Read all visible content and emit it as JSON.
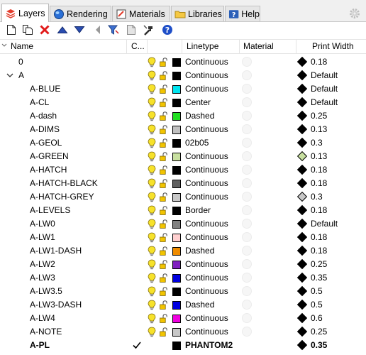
{
  "tabs": [
    {
      "label": "Layers",
      "icon": "layers-icon",
      "active": true
    },
    {
      "label": "Rendering",
      "icon": "rendering-icon",
      "active": false
    },
    {
      "label": "Materials",
      "icon": "materials-icon",
      "active": false
    },
    {
      "label": "Libraries",
      "icon": "libraries-icon",
      "active": false
    },
    {
      "label": "Help",
      "icon": "help-icon",
      "active": false
    }
  ],
  "toolbar": [
    {
      "name": "new-layer-icon"
    },
    {
      "name": "new-sublayer-icon"
    },
    {
      "name": "delete-icon"
    },
    {
      "name": "move-up-icon"
    },
    {
      "name": "move-down-icon"
    },
    {
      "name": "move-to-parent-icon"
    },
    {
      "name": "filter-icon"
    },
    {
      "name": "layer-states-icon"
    },
    {
      "name": "tools-icon"
    },
    {
      "name": "help-icon"
    }
  ],
  "columns": {
    "name": "Name",
    "current": "C...",
    "linetype": "Linetype",
    "material": "Material",
    "print_width": "Print Width"
  },
  "layers": [
    {
      "name": "0",
      "level": 0,
      "color": "#000000",
      "linetype": "Continuous",
      "print_color": "#000000",
      "print_width": "0.18"
    },
    {
      "name": "A",
      "level": 0,
      "expanded": true,
      "color": "#000000",
      "linetype": "Continuous",
      "print_color": "#000000",
      "print_width": "Default"
    },
    {
      "name": "A-BLUE",
      "level": 1,
      "color": "#00e5f0",
      "linetype": "Continuous",
      "print_color": "#000000",
      "print_width": "Default"
    },
    {
      "name": "A-CL",
      "level": 1,
      "color": "#000000",
      "linetype": "Center",
      "print_color": "#000000",
      "print_width": "Default"
    },
    {
      "name": "A-dash",
      "level": 1,
      "color": "#22e022",
      "linetype": "Dashed",
      "print_color": "#000000",
      "print_width": "0.25"
    },
    {
      "name": "A-DIMS",
      "level": 1,
      "color": "#c0c0c0",
      "linetype": "Continuous",
      "print_color": "#000000",
      "print_width": "0.13"
    },
    {
      "name": "A-GEOL",
      "level": 1,
      "color": "#000000",
      "linetype": "02b05",
      "print_color": "#000000",
      "print_width": "0.3"
    },
    {
      "name": "A-GREEN",
      "level": 1,
      "color": "#c8e0a0",
      "linetype": "Continuous",
      "print_color": "#c8e0a0",
      "print_width": "0.13"
    },
    {
      "name": "A-HATCH",
      "level": 1,
      "color": "#000000",
      "linetype": "Continuous",
      "print_color": "#000000",
      "print_width": "0.18"
    },
    {
      "name": "A-HATCH-BLACK",
      "level": 1,
      "color": "#606060",
      "linetype": "Continuous",
      "print_color": "#000000",
      "print_width": "0.18"
    },
    {
      "name": "A-HATCH-GREY",
      "level": 1,
      "color": "#c8c8c8",
      "linetype": "Continuous",
      "print_color": "#c8c8c8",
      "print_width": "0.3"
    },
    {
      "name": "A-LEVELS",
      "level": 1,
      "color": "#000000",
      "linetype": "Border",
      "print_color": "#000000",
      "print_width": "0.18"
    },
    {
      "name": "A-LW0",
      "level": 1,
      "color": "#808080",
      "linetype": "Continuous",
      "print_color": "#000000",
      "print_width": "Default"
    },
    {
      "name": "A-LW1",
      "level": 1,
      "color": "#ffd0d0",
      "linetype": "Continuous",
      "print_color": "#000000",
      "print_width": "0.18"
    },
    {
      "name": "A-LW1-DASH",
      "level": 1,
      "color": "#f08c00",
      "linetype": "Dashed",
      "print_color": "#000000",
      "print_width": "0.18"
    },
    {
      "name": "A-LW2",
      "level": 1,
      "color": "#8020c0",
      "linetype": "Continuous",
      "print_color": "#000000",
      "print_width": "0.25"
    },
    {
      "name": "A-LW3",
      "level": 1,
      "color": "#0000e0",
      "linetype": "Continuous",
      "print_color": "#000000",
      "print_width": "0.35"
    },
    {
      "name": "A-LW3.5",
      "level": 1,
      "color": "#000000",
      "linetype": "Continuous",
      "print_color": "#000000",
      "print_width": "0.5"
    },
    {
      "name": "A-LW3-DASH",
      "level": 1,
      "color": "#0000e0",
      "linetype": "Dashed",
      "print_color": "#000000",
      "print_width": "0.5"
    },
    {
      "name": "A-LW4",
      "level": 1,
      "color": "#f000e0",
      "linetype": "Continuous",
      "print_color": "#000000",
      "print_width": "0.6"
    },
    {
      "name": "A-NOTE",
      "level": 1,
      "color": "#c8c8c8",
      "linetype": "Continuous",
      "print_color": "#000000",
      "print_width": "0.25"
    },
    {
      "name": "A-PL",
      "level": 1,
      "current": true,
      "color": "#000000",
      "linetype": "PHANTOM2",
      "print_color": "#000000",
      "print_width": "0.35"
    }
  ]
}
